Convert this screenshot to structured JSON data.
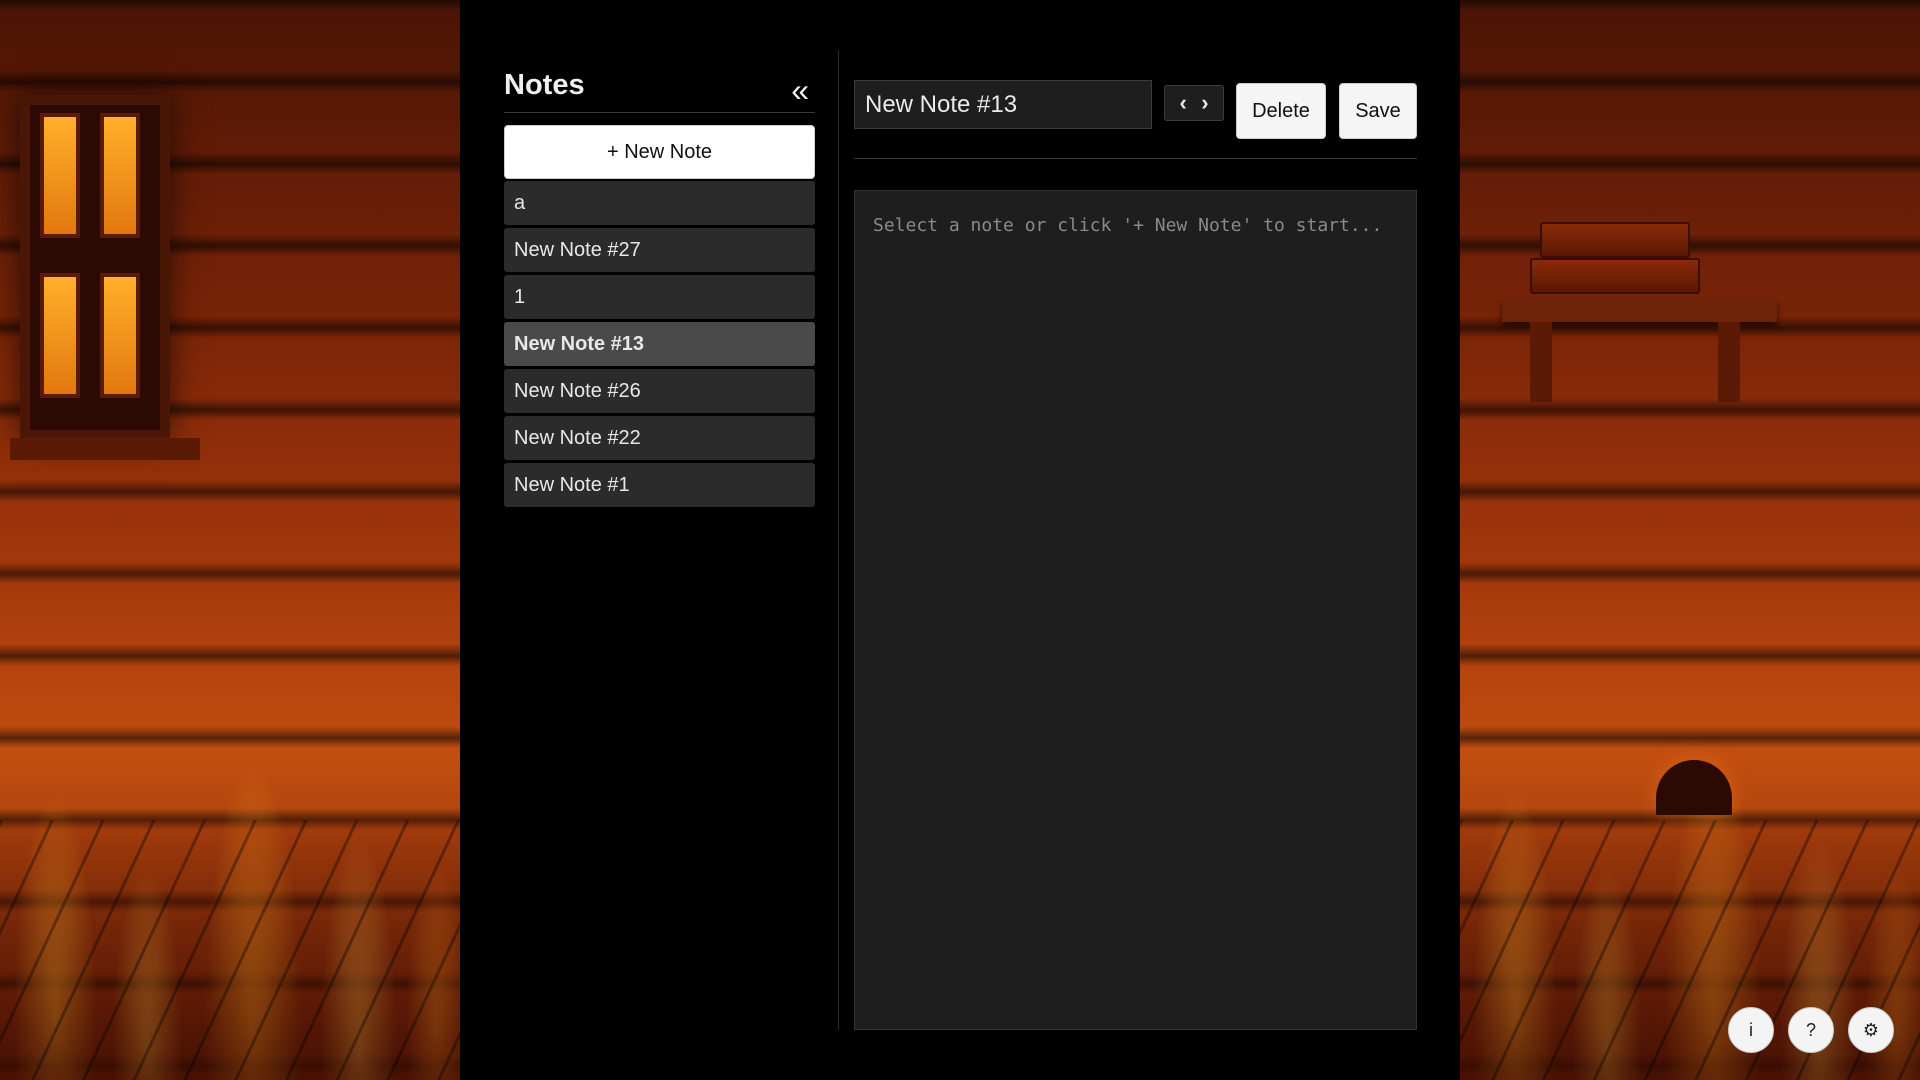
{
  "sidebar": {
    "title": "Notes",
    "collapse_icon": "«",
    "new_note_label": "+ New Note",
    "notes": [
      {
        "label": "a",
        "active": false
      },
      {
        "label": "New Note #27",
        "active": false
      },
      {
        "label": "1",
        "active": false
      },
      {
        "label": "New Note #13",
        "active": true
      },
      {
        "label": "New Note #26",
        "active": false
      },
      {
        "label": "New Note #22",
        "active": false
      },
      {
        "label": "New Note #1",
        "active": false
      }
    ]
  },
  "editor": {
    "title_value": "New Note #13",
    "prev_icon": "‹",
    "next_icon": "›",
    "delete_label": "Delete",
    "save_label": "Save",
    "content_value": "",
    "content_placeholder": "Select a note or click '+ New Note' to start..."
  },
  "corner_buttons": {
    "info_label": "i",
    "help_label": "?",
    "settings_label": "⚙"
  },
  "colors": {
    "panel_bg": "#000000",
    "note_item_bg": "#2b2b2b",
    "note_item_active_bg": "#4a4a4a",
    "editor_bg": "#1e1e1e",
    "fire_orange": "#c24e10"
  }
}
